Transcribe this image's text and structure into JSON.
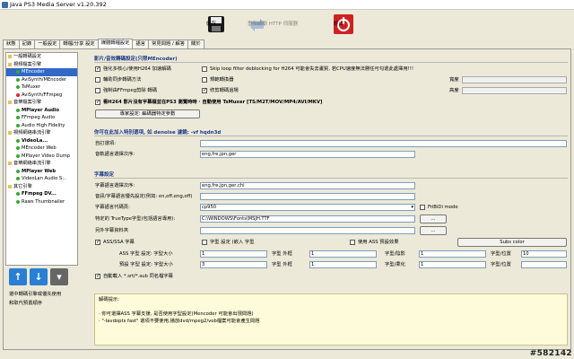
{
  "window": {
    "title": "Java PS3 Media Server v1.20.392"
  },
  "toolbar": {
    "save": "儲存",
    "restart": "重新啟動 HTTP 伺服器",
    "quit": "終止"
  },
  "tabs": [
    "狀態",
    "記錄",
    "一般設定",
    "轉檔/分享 設定",
    "媒體轉檔設定",
    "語言",
    "常見問題 / 解答",
    "關於"
  ],
  "tree": [
    {
      "label": "一般轉碼設定",
      "lvl": 0,
      "bold": false,
      "icon": "folder"
    },
    {
      "label": "視頻檔案引擎",
      "lvl": 0,
      "bold": false,
      "icon": "folder"
    },
    {
      "label": "MEncoder",
      "lvl": 1,
      "bold": false,
      "icon": "green",
      "sel": true
    },
    {
      "label": "AviSynth/MEncoder",
      "lvl": 1,
      "bold": false,
      "icon": "green"
    },
    {
      "label": "TsMuxer",
      "lvl": 1,
      "bold": false,
      "icon": "green"
    },
    {
      "label": "AviSynth/FFmpeg",
      "lvl": 1,
      "bold": false,
      "icon": "red"
    },
    {
      "label": "音樂檔案引擎",
      "lvl": 0,
      "bold": false,
      "icon": "folder"
    },
    {
      "label": "MPlayer Audio",
      "lvl": 1,
      "bold": true,
      "icon": "green"
    },
    {
      "label": "FFmpeg Audio",
      "lvl": 1,
      "bold": false,
      "icon": "green"
    },
    {
      "label": "Audio High Fidelity",
      "lvl": 1,
      "bold": false,
      "icon": "green"
    },
    {
      "label": "視頻網絡串流引擎",
      "lvl": 0,
      "bold": false,
      "icon": "folder"
    },
    {
      "label": "VideoLa...",
      "lvl": 1,
      "bold": true,
      "icon": "green"
    },
    {
      "label": "MEncoder Web",
      "lvl": 1,
      "bold": false,
      "icon": "green"
    },
    {
      "label": "MPlayer Video Dump",
      "lvl": 1,
      "bold": false,
      "icon": "green"
    },
    {
      "label": "音樂網絡串流引擎",
      "lvl": 0,
      "bold": false,
      "icon": "folder"
    },
    {
      "label": "MPlayer Web",
      "lvl": 1,
      "bold": true,
      "icon": "green"
    },
    {
      "label": "VideoLan Audio S...",
      "lvl": 1,
      "bold": false,
      "icon": "green"
    },
    {
      "label": "其它引擎",
      "lvl": 0,
      "bold": false,
      "icon": "folder"
    },
    {
      "label": "FFmpeg DV...",
      "lvl": 1,
      "bold": true,
      "icon": "green"
    },
    {
      "label": "Raws Thumbnailer",
      "lvl": 1,
      "bold": false,
      "icon": "green"
    }
  ],
  "side": {
    "note1": "選中轉碼引擎或優先使用",
    "note2": "和取代預置順序"
  },
  "sec1": {
    "title": "影片/音效轉碼設定(只限MEncoder)",
    "c1": "強化多核心/使用H264 加速解碼",
    "c2": "Skip loop filter deblocking for H264 可能會失去畫質, 若CPU速度無法勝任可勾選此處擇用!!!",
    "c3": "輔助同步轉碼方法",
    "c4": "規範轉換器",
    "c5": "寬度",
    "c6": "強制由FFmpeg剪除 轉碼",
    "c7": "修剪轉碼過場",
    "c8": "高度",
    "c9": "看H264 影片沒有字幕檔並在PS3 瀏覽時時 · 自動使用 TsMuxer [TS/M2T/MOV/MP4/AVI/MKV]",
    "btn": "專家設定: 編碼器特定參數"
  },
  "sec2": {
    "title": "你可在此加入特別選項, 如 denoise 濾鏡: -vf hqdn3d",
    "l1": "自訂選項:",
    "l2": "音軌語言選擇次序:",
    "v2": "eng,fre,jpn,ger"
  },
  "sec3": {
    "title": "字幕設定",
    "l1": "字幕語言選擇次序:",
    "v1": "eng,fre,jpn,ger,chi",
    "l2": "音訊/字幕語言優先設定(例如: en,off,eng,off)",
    "l3": "字幕語言代碼頁:",
    "v3": "cp950",
    "c_fribidi": "FriBiDi mode",
    "l4": "特定的 TrueType字型(包括語言專用):",
    "v4": "C:\\WINDOWS\\Fonts\\MSJH.TTF",
    "dots": "...",
    "l5": "另外字幕資料夾",
    "c_ass": "ASS/SSA 字幕",
    "c_outline": "字型 設定 (嵌入 字型",
    "c_asspref": "使用 ASS 預設效果",
    "color_btn": "Subs color",
    "r1": {
      "l": "ASS 字型 設定: 字型大小",
      "v": "1",
      "l2": "字型 外框",
      "v2": "1",
      "l3": "字型/陰影",
      "v3": "1",
      "l4": "字型/位置",
      "v4": "10"
    },
    "r2": {
      "l": "預設 字型 設定: 字型大小",
      "v": "3",
      "l2": "字型 外框",
      "v2": "1",
      "l3": "字型/柔化",
      "v3": "1",
      "l4": "字型/位置",
      "v4": ""
    },
    "c_auto": "自動載入 *.srt/*.sub 同名檔字幕"
  },
  "notes": {
    "title": "解碼提示:",
    "line1": "· 你可選擇ASS 字幕支援, 是否使用字型設定(Mencoder 可能會出現問題)",
    "line2": "· \"-lavdopts fast\" 選項不要使用,播放dvd/mpeg2/vob檔案可能會產生問題"
  },
  "watermark": "#582142",
  "colors": {
    "accent": "#1f3c88",
    "save_icon": "#1a1a1a",
    "restart_icon": "#8aa5c4",
    "quit_icon": "#cc2222",
    "arrow_up": "#2a7fd4",
    "arrow_down": "#2a7fd4",
    "arrow_other": "#555"
  }
}
